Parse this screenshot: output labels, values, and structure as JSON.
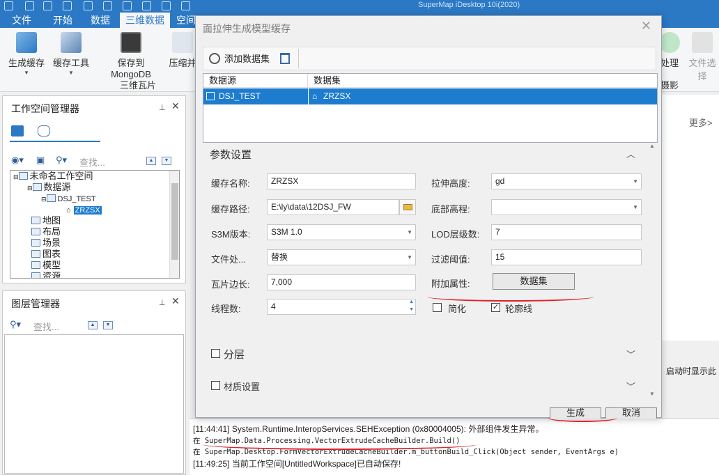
{
  "app_title": "SuperMap iDesktop 10i(2020)",
  "menu": [
    "文件",
    "开始",
    "数据",
    "三维数据",
    "空间"
  ],
  "ribbon": {
    "buttons": [
      {
        "label": "生成缓存",
        "icon": "cache-generate-icon"
      },
      {
        "label": "缓存工具",
        "icon": "cache-tools-icon"
      },
      {
        "label": "保存到MongoDB",
        "icon": "mongodb-icon"
      },
      {
        "label": "压缩并",
        "icon": "compress-icon"
      }
    ],
    "group_label": "三维瓦片",
    "right_buttons": [
      {
        "label": "处理"
      },
      {
        "label": "文件选择"
      }
    ],
    "right_group_label": "摄影"
  },
  "workspace_panel": {
    "title": "工作空间管理器",
    "search_placeholder": "查找...",
    "tree": [
      {
        "label": "未命名工作空间",
        "level": 0
      },
      {
        "label": "数据源",
        "level": 1
      },
      {
        "label": "DSJ_TEST",
        "level": 2
      },
      {
        "label": "ZRZSX",
        "level": 3,
        "selected": true
      },
      {
        "label": "地图",
        "level": 1
      },
      {
        "label": "布局",
        "level": 1
      },
      {
        "label": "场景",
        "level": 1
      },
      {
        "label": "图表",
        "level": 1
      },
      {
        "label": "模型",
        "level": 1
      },
      {
        "label": "资源",
        "level": 1
      }
    ]
  },
  "layer_panel": {
    "title": "图层管理器",
    "search_placeholder": "查找..."
  },
  "background": {
    "more": "更多>",
    "startup_text": "启动时显示此"
  },
  "dialog": {
    "title": "面拉伸生成模型缓存",
    "add_dataset": "添加数据集",
    "grid_headers": [
      "数据源",
      "数据集"
    ],
    "grid_row": {
      "datasource": "DSJ_TEST",
      "dataset": "ZRZSX"
    },
    "params_title": "参数设置",
    "fields": {
      "cache_name_label": "缓存名称:",
      "cache_name": "ZRZSX",
      "cache_path_label": "缓存路径:",
      "cache_path": "E:\\ly\\data\\12DSJ_FW",
      "s3m_label": "S3M版本:",
      "s3m": "S3M 1.0",
      "file_label": "文件处...",
      "file": "替换",
      "tile_label": "瓦片边长:",
      "tile": "7,000",
      "thread_label": "线程数:",
      "thread": "4",
      "extrude_label": "拉伸高度:",
      "extrude": "gd",
      "base_label": "底部高程:",
      "base": "",
      "lod_label": "LOD层级数:",
      "lod": "7",
      "filter_label": "过滤阈值:",
      "filter": "15",
      "attr_label": "附加属性:",
      "attr_button": "数据集",
      "simplify": "简化",
      "simplify_checked": false,
      "outline": "轮廓线",
      "outline_checked": true
    },
    "layer_section": "分层",
    "material_section": "材质设置",
    "generate": "生成",
    "cancel": "取消"
  },
  "log": [
    "[11:44:41] System.Runtime.InteropServices.SEHException (0x80004005): 外部组件发生异常。",
    "   在 SuperMap.Data.Processing.VectorExtrudeCacheBuilder.Build()",
    "   在 SuperMap.Desktop.FormVectorExtrudeCacheBuilder.m_buttonBuild_Click(Object sender, EventArgs e)",
    "[11:49:25] 当前工作空间[UntitledWorkspace]已自动保存!"
  ],
  "colors": {
    "accent": "#2b78c5",
    "selection": "#1e7ccf",
    "annotation": "#e0202a"
  }
}
